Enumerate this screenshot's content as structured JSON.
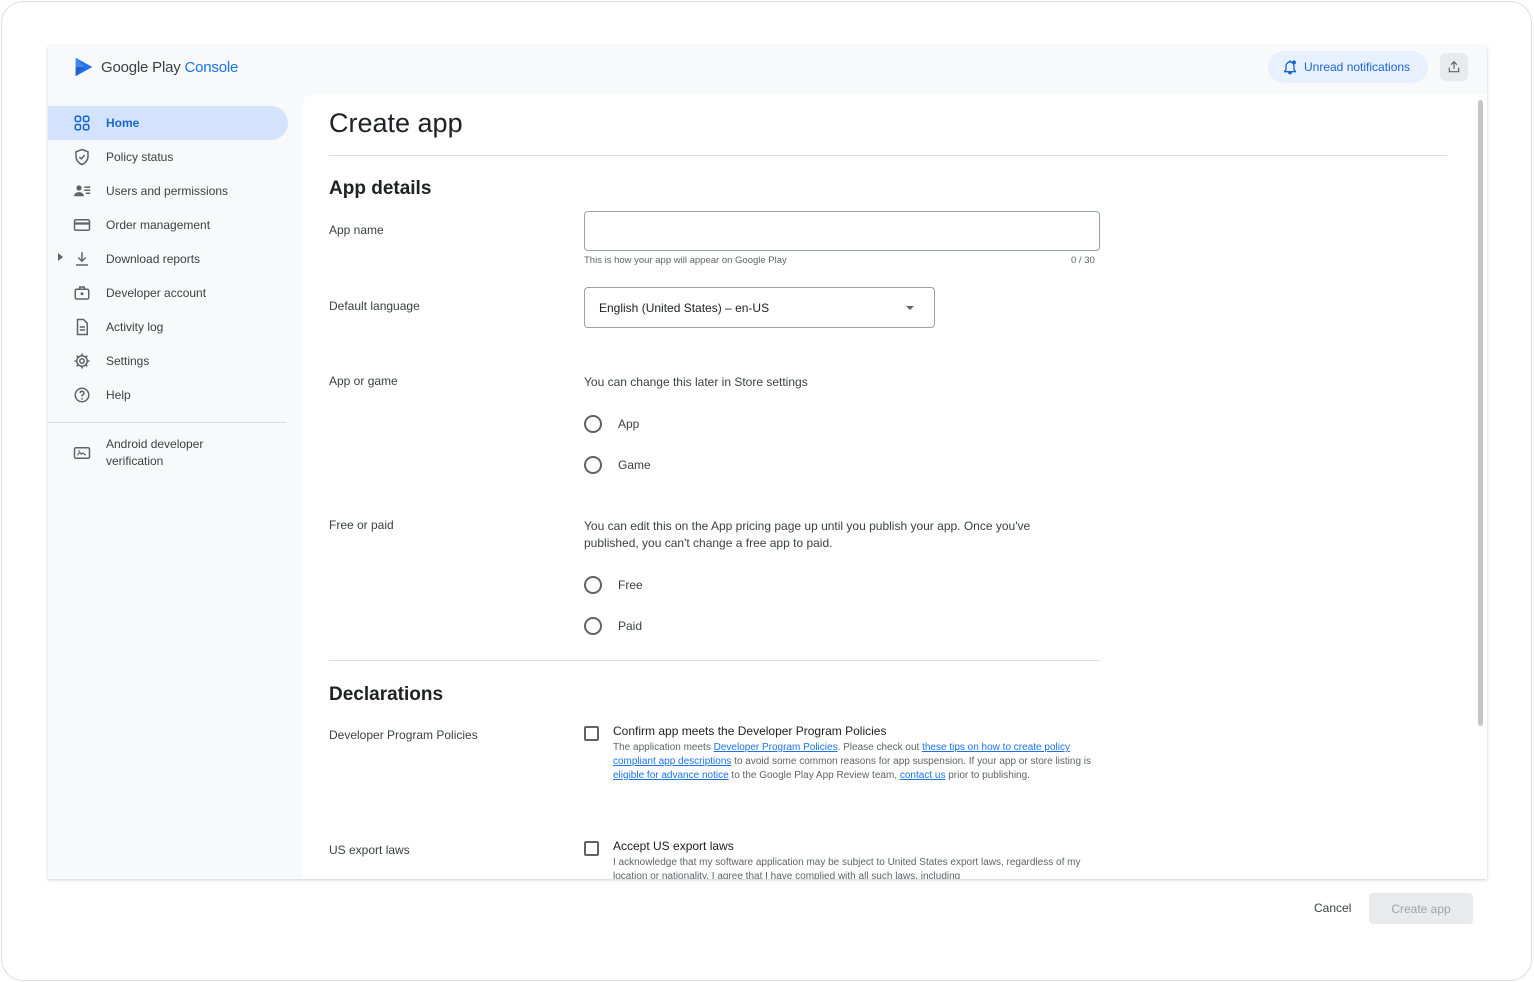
{
  "header": {
    "brand_prefix": "Google Play",
    "brand_suffix": "Console",
    "notifications_label": "Unread notifications",
    "share_icon": "share-icon"
  },
  "sidebar": {
    "items": [
      {
        "label": "Home",
        "icon": "home-grid-icon",
        "active": true
      },
      {
        "label": "Policy status",
        "icon": "shield-icon"
      },
      {
        "label": "Users and permissions",
        "icon": "users-icon"
      },
      {
        "label": "Order management",
        "icon": "credit-card-icon"
      },
      {
        "label": "Download reports",
        "icon": "download-icon",
        "expandable": true
      },
      {
        "label": "Developer account",
        "icon": "briefcase-icon"
      },
      {
        "label": "Activity log",
        "icon": "document-icon"
      },
      {
        "label": "Settings",
        "icon": "gear-icon"
      },
      {
        "label": "Help",
        "icon": "help-icon"
      }
    ],
    "extra_item": {
      "label": "Android developer\nverification",
      "icon": "id-card-icon"
    }
  },
  "main": {
    "title": "Create app",
    "app_details": {
      "heading": "App details",
      "app_name_label": "App name",
      "app_name_value": "",
      "app_name_helper": "This is how your app will appear on Google Play",
      "app_name_counter": "0 / 30",
      "default_language_label": "Default language",
      "default_language_value": "English (United States) – en-US",
      "app_or_game_label": "App or game",
      "app_or_game_hint": "You can change this later in Store settings",
      "app_or_game_options": [
        "App",
        "Game"
      ],
      "free_or_paid_label": "Free or paid",
      "free_or_paid_hint": "You can edit this on the App pricing page up until you publish your app. Once you've published, you can't change a free app to paid.",
      "free_or_paid_options": [
        "Free",
        "Paid"
      ]
    },
    "declarations": {
      "heading": "Declarations",
      "policies_label": "Developer Program Policies",
      "policies_title": "Confirm app meets the Developer Program Policies",
      "policies_desc": {
        "t1": "The application meets ",
        "l1": "Developer Program Policies",
        "t2": ". Please check out ",
        "l2": "these tips on how to create policy compliant app descriptions",
        "t3": " to avoid some common reasons for app suspension. If your app or store listing is ",
        "l3": "eligible for advance notice",
        "t4": " to the Google Play App Review team, ",
        "l4": "contact us",
        "t5": " prior to publishing."
      },
      "export_label": "US export laws",
      "export_title": "Accept US export laws",
      "export_desc": "I acknowledge that my software application may be subject to United States export laws, regardless of my location or nationality. I agree that I have complied with all such laws, including"
    }
  },
  "footer": {
    "cancel_label": "Cancel",
    "create_label": "Create app"
  }
}
